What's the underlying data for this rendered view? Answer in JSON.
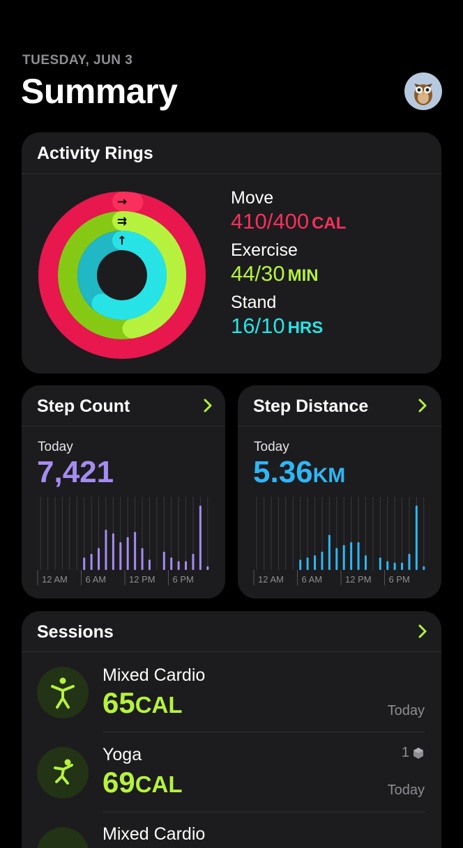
{
  "header": {
    "date": "TUESDAY, JUN 3",
    "title": "Summary"
  },
  "activity": {
    "title": "Activity Rings",
    "move": {
      "label": "Move",
      "value": "410/400",
      "unit": "CAL",
      "color": "#fa2f5c",
      "progress": 1.025
    },
    "exercise": {
      "label": "Exercise",
      "value": "44/30",
      "unit": "MIN",
      "color": "#b6f23d",
      "progress": 1.47
    },
    "stand": {
      "label": "Stand",
      "value": "16/10",
      "unit": "HRS",
      "color": "#28e3e6",
      "progress": 1.6
    }
  },
  "step_count": {
    "title": "Step Count",
    "period": "Today",
    "value": "7,421",
    "unit": "",
    "color": "#a58cf0",
    "x_labels": [
      "12 AM",
      "6 AM",
      "12 PM",
      "6 PM"
    ]
  },
  "step_distance": {
    "title": "Step Distance",
    "period": "Today",
    "value": "5.36",
    "unit": "KM",
    "color": "#2fb6f5",
    "x_labels": [
      "12 AM",
      "6 AM",
      "12 PM",
      "6 PM"
    ]
  },
  "chart_data": [
    {
      "type": "bar",
      "title": "Step Count",
      "categories": [
        "0",
        "1",
        "2",
        "3",
        "4",
        "5",
        "6",
        "7",
        "8",
        "9",
        "10",
        "11",
        "12",
        "13",
        "14",
        "15",
        "16",
        "17",
        "18",
        "19",
        "20",
        "21",
        "22",
        "23"
      ],
      "values": [
        0,
        0,
        0,
        0,
        0,
        0,
        0.17,
        0.22,
        0.3,
        0.55,
        0.5,
        0.38,
        0.45,
        0.52,
        0.3,
        0.14,
        0,
        0.25,
        0.17,
        0.12,
        0.12,
        0.22,
        0.88,
        0.05
      ],
      "tick_labels": [
        "12 AM",
        "6 AM",
        "12 PM",
        "6 PM"
      ],
      "color": "#a58cf0"
    },
    {
      "type": "bar",
      "title": "Step Distance",
      "categories": [
        "0",
        "1",
        "2",
        "3",
        "4",
        "5",
        "6",
        "7",
        "8",
        "9",
        "10",
        "11",
        "12",
        "13",
        "14",
        "15",
        "16",
        "17",
        "18",
        "19",
        "20",
        "21",
        "22",
        "23"
      ],
      "values": [
        0,
        0,
        0,
        0,
        0,
        0,
        0.14,
        0.17,
        0.2,
        0.25,
        0.48,
        0.3,
        0.34,
        0.38,
        0.38,
        0.2,
        0,
        0.17,
        0.12,
        0.1,
        0.1,
        0.22,
        0.88,
        0.05
      ],
      "tick_labels": [
        "12 AM",
        "6 AM",
        "12 PM",
        "6 PM"
      ],
      "color": "#2fb6f5"
    }
  ],
  "sessions": {
    "title": "Sessions",
    "items": [
      {
        "name": "Mixed Cardio",
        "value": "65",
        "unit": "CAL",
        "date": "Today",
        "badge": ""
      },
      {
        "name": "Yoga",
        "value": "69",
        "unit": "CAL",
        "date": "Today",
        "badge": "1"
      },
      {
        "name": "Mixed Cardio",
        "value": "",
        "unit": "",
        "date": "",
        "badge": ""
      }
    ]
  }
}
